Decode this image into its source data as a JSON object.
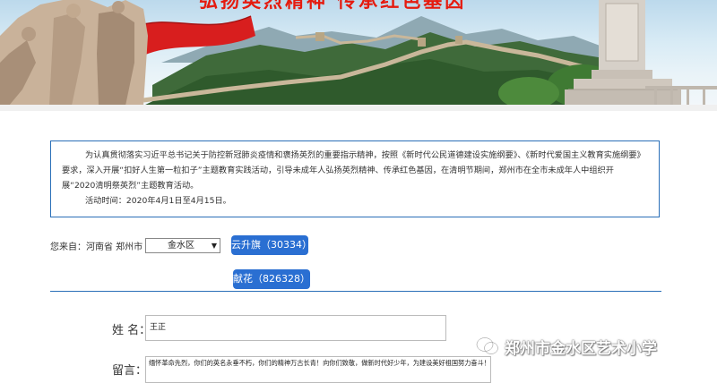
{
  "banner": {
    "title": "弘扬英烈精神 传承红色基因"
  },
  "notice": {
    "paragraph": "为认真贯彻落实习近平总书记关于防控新冠肺炎疫情和褒扬英烈的重要指示精神，按照《新时代公民道德建设实施纲要》、《新时代爱国主义教育实施纲要》要求，深入开展“扣好人生第一粒扣子”主题教育实践活动，引导未成年人弘扬英烈精神、传承红色基因，在清明节期间，郑州市在全市未成年人中组织开展“2020清明祭英烈”主题教育活动。",
    "activity_time": "活动时间：2020年4月1日至4月15日。"
  },
  "location": {
    "label": "您来自：河南省 郑州市",
    "district_selected": "金水区"
  },
  "actions": {
    "raise_flag": "云升旗（30334）",
    "offer_flowers": "献花（826328）"
  },
  "form": {
    "name_label": "姓 名：",
    "name_value": "王正",
    "message_label": "留言：",
    "message_value": "缅怀革命先烈，你们的英名永垂不朽，你们的精神万古长青！向你们致敬，做新时代好少年，为建设美好祖国努力奋斗！"
  },
  "watermark": {
    "text": "郑州市金水区艺术小学"
  },
  "colors": {
    "accent_blue": "#2a6fd2",
    "border_blue": "#2a6fb8",
    "banner_red": "#e51b0f"
  }
}
